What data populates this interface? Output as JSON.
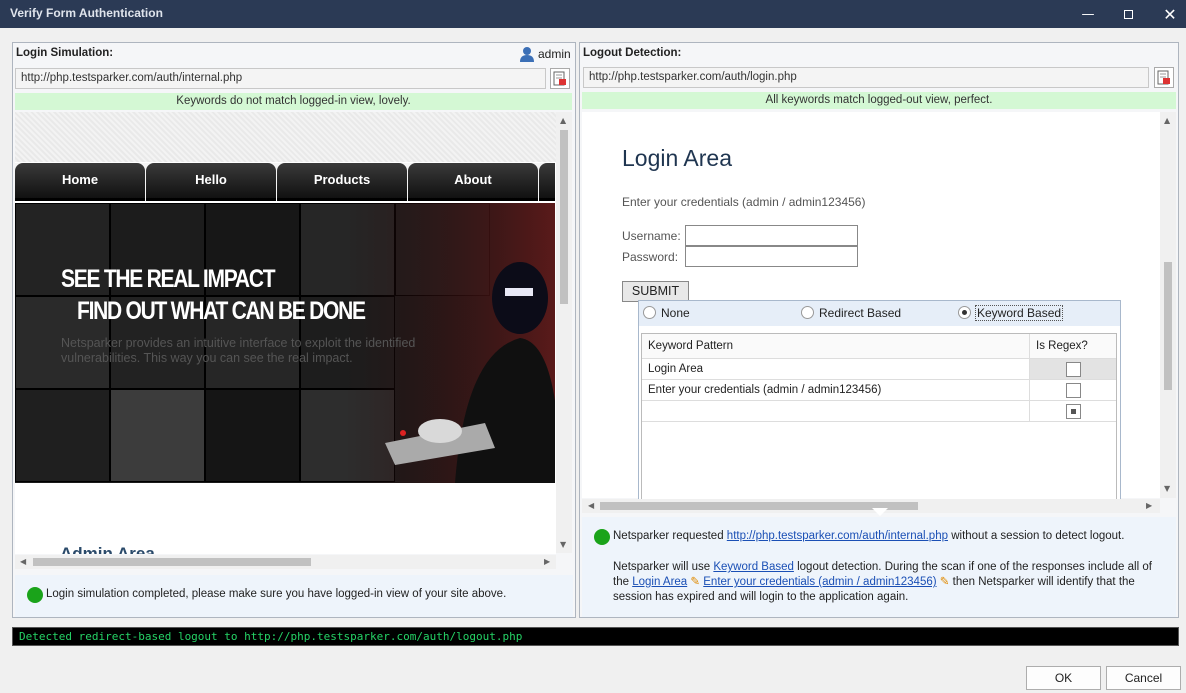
{
  "window": {
    "title": "Verify Form Authentication"
  },
  "login": {
    "header": "Login Simulation:",
    "user": "admin",
    "url": "http://php.testsparker.com/auth/internal.php",
    "keyword_status": "Keywords do not match logged-in view, lovely.",
    "nav": [
      "Home",
      "Hello",
      "Products",
      "About"
    ],
    "hero_line1": "SEE THE REAL IMPACT",
    "hero_line2": "FIND OUT WHAT CAN BE DONE",
    "hero_text": "Netsparker provides an intuitive interface to exploit the identified vulnerabilities. This way you can see the real impact.",
    "below_text": "Admin Area",
    "status": "Login simulation completed, please make sure you have logged-in view of your site above."
  },
  "logout": {
    "header": "Logout Detection:",
    "url": "http://php.testsparker.com/auth/login.php",
    "keyword_status": "All keywords match logged-out view, perfect.",
    "page": {
      "title": "Login Area",
      "subtitle": "Enter your credentials (admin / admin123456)",
      "username_label": "Username:",
      "password_label": "Password:",
      "submit": "SUBMIT"
    },
    "options": [
      "None",
      "Redirect Based",
      "Keyword Based"
    ],
    "selected_option": "Keyword Based",
    "table": {
      "headers": [
        "Keyword Pattern",
        "Is Regex?"
      ],
      "rows": [
        {
          "pattern": "Login Area",
          "regex": false
        },
        {
          "pattern": "Enter your credentials (admin / admin123456)",
          "regex": false
        },
        {
          "pattern": "",
          "regex": "indeterminate"
        }
      ]
    },
    "info1_prefix": "Netsparker requested",
    "info1_link": "http://php.testsparker.com/auth/internal.php",
    "info1_suffix": "without a session to detect logout.",
    "info2_a": "Netsparker will use",
    "info2_link": "Keyword Based",
    "info2_b": "logout detection. During the scan if one of the responses include all of the",
    "info2_kw1": "Login Area",
    "info2_kw2": "Enter your credentials (admin / admin123456)",
    "info2_c": "then Netsparker will identify that the session has expired and will login to the application again."
  },
  "console": "Detected redirect-based logout to http://php.testsparker.com/auth/logout.php",
  "buttons": {
    "ok": "OK",
    "cancel": "Cancel"
  },
  "colors": {
    "accent": "#2b3a55",
    "success": "#1aa31a",
    "ok_bar": "#d4f8d4",
    "console_text": "#25d366"
  }
}
